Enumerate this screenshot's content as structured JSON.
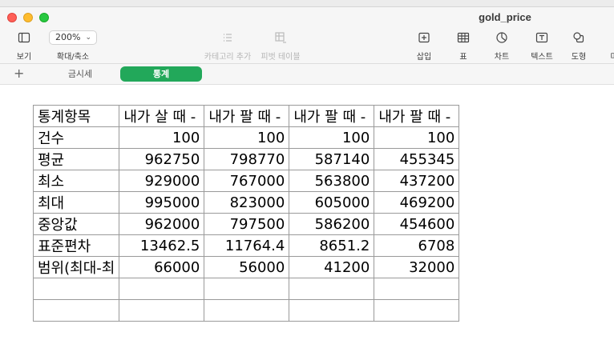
{
  "window": {
    "title": "gold_price"
  },
  "toolbar": {
    "view": "보기",
    "zoom_value": "200%",
    "zoom_label": "확대/축소",
    "category_add": "카테고리 추가",
    "pivot_table": "피벗 테이블",
    "insert": "삽입",
    "table": "표",
    "chart": "차트",
    "text": "텍스트",
    "shape": "도형",
    "media_partial": "미"
  },
  "sheets": {
    "add": "+",
    "tabs": [
      {
        "label": "금시세",
        "active": false
      },
      {
        "label": "통계",
        "active": true
      }
    ]
  },
  "table": {
    "header": [
      "통계항목",
      "내가 살 때 -",
      "내가 팔 때 -",
      "내가 팔 때 -",
      "내가 팔 때 -"
    ],
    "rows": [
      [
        "건수",
        "100",
        "100",
        "100",
        "100"
      ],
      [
        "평균",
        "962750",
        "798770",
        "587140",
        "455345"
      ],
      [
        "최소",
        "929000",
        "767000",
        "563800",
        "437200"
      ],
      [
        "최대",
        "995000",
        "823000",
        "605000",
        "469200"
      ],
      [
        "중앙값",
        "962000",
        "797500",
        "586200",
        "454600"
      ],
      [
        "표준편차",
        "13462.5",
        "11764.4",
        "8651.2",
        "6708"
      ],
      [
        "범위(최대-최",
        "66000",
        "56000",
        "41200",
        "32000"
      ],
      [
        "",
        "",
        "",
        "",
        ""
      ],
      [
        "",
        "",
        "",
        "",
        ""
      ]
    ]
  },
  "colors": {
    "accent_tab": "#22a85a",
    "close": "#ff5f57",
    "minimize": "#febc2e",
    "maximize": "#28c840"
  }
}
